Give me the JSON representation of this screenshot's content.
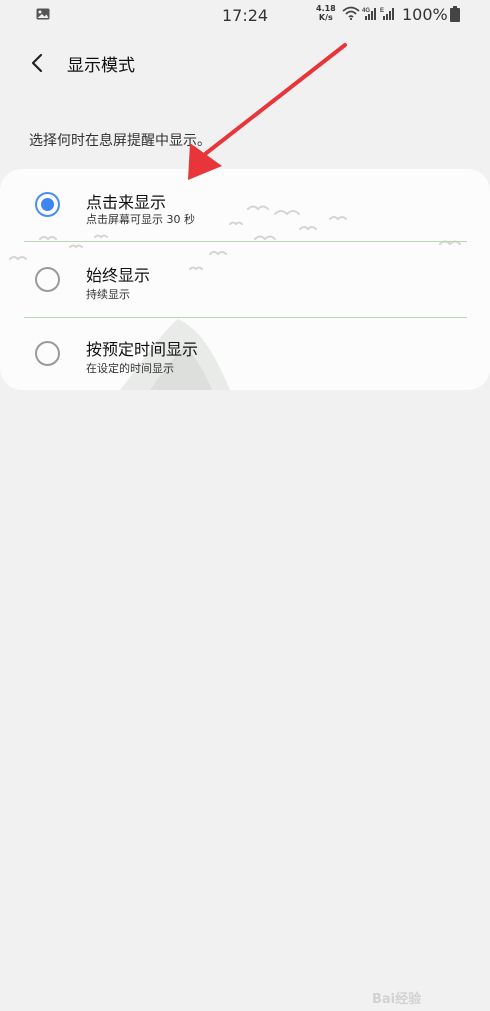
{
  "status_bar": {
    "time": "17:24",
    "speed_value": "4.18",
    "speed_unit": "K/s",
    "battery_pct": "100%"
  },
  "header": {
    "title": "显示模式"
  },
  "description": "选择何时在息屏提醒中显示。",
  "options": [
    {
      "title": "点击来显示",
      "subtitle": "点击屏幕可显示 30 秒",
      "selected": true
    },
    {
      "title": "始终显示",
      "subtitle": "持续显示",
      "selected": false
    },
    {
      "title": "按预定时间显示",
      "subtitle": "在设定的时间显示",
      "selected": false
    }
  ],
  "watermark": "Bai经验",
  "colors": {
    "accent": "#3d86f2",
    "annotation_arrow": "#e8353a",
    "background": "#f2f1f1",
    "divider": "#b9d6bd"
  }
}
